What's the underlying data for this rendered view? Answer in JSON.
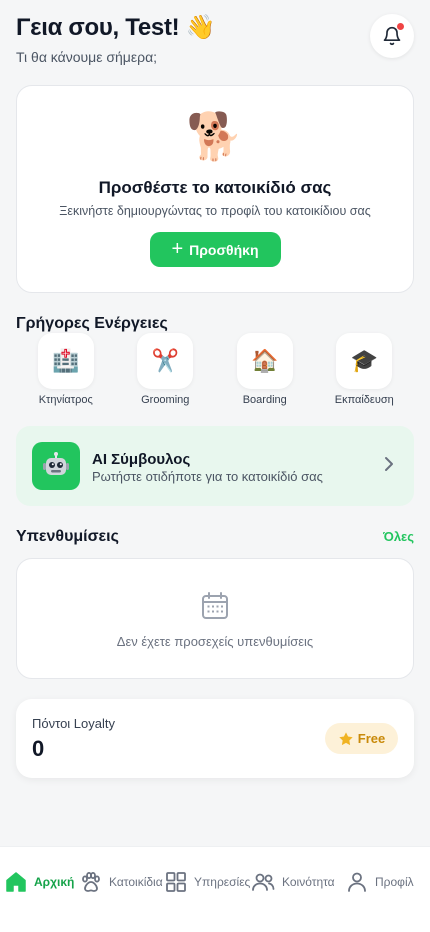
{
  "header": {
    "greeting": "Γεια σου, Test! 👋",
    "subtitle": "Τι θα κάνουμε σήμερα;",
    "notification_icon": "bell-icon",
    "has_unread": true
  },
  "empty_pet": {
    "emoji": "🐕",
    "title": "Προσθέστε το κατοικίδιό σας",
    "description": "Ξεκινήστε δημιουργώντας το προφίλ του κατοικίδιου σας",
    "add_button": "Προσθήκη"
  },
  "quick_actions": {
    "title": "Γρήγορες Ενέργειες",
    "items": [
      {
        "label": "Κτηνίατρος",
        "emoji": "🏥"
      },
      {
        "label": "Grooming",
        "emoji": "✂️"
      },
      {
        "label": "Boarding",
        "emoji": "🏠"
      },
      {
        "label": "Εκπαίδευση",
        "emoji": "🎓"
      }
    ]
  },
  "ai_assistant": {
    "title": "AI Σύμβουλος",
    "subtitle": "Ρωτήστε οτιδήποτε για το κατοικίδιό σας",
    "icon": "robot-icon"
  },
  "reminders": {
    "title": "Υπενθυμίσεις",
    "see_all": "Όλες",
    "empty_text": "Δεν έχετε προσεχείς υπενθυμίσεις"
  },
  "loyalty": {
    "label": "Πόντοι Loyalty",
    "points": "0",
    "tier": "Free"
  },
  "nav": {
    "items": [
      {
        "label": "Αρχική",
        "icon": "home-icon",
        "active": true
      },
      {
        "label": "Κατοικίδια",
        "icon": "paw-icon",
        "active": false
      },
      {
        "label": "Υπηρεσίες",
        "icon": "grid-icon",
        "active": false
      },
      {
        "label": "Κοινότητα",
        "icon": "users-icon",
        "active": false
      },
      {
        "label": "Προφίλ",
        "icon": "user-icon",
        "active": false
      }
    ]
  },
  "colors": {
    "accent": "#22c55e",
    "accent_light": "#e8f7ee",
    "badge_bg": "#fdf1d8",
    "badge_text": "#c98a0a",
    "notification_dot": "#ef4444"
  }
}
